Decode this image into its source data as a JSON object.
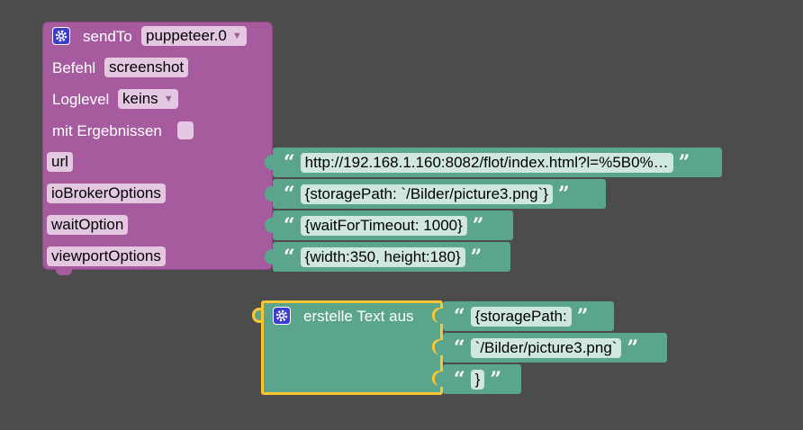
{
  "sendto": {
    "title": "sendTo",
    "instance": "puppeteer.0",
    "befehl_label": "Befehl",
    "befehl_value": "screenshot",
    "loglevel_label": "Loglevel",
    "loglevel_value": "keins",
    "results_label": "mit Ergebnissen",
    "inputs": [
      {
        "label": "url",
        "value": "http://192.168.1.160:8082/flot/index.html?l=%5B0%…"
      },
      {
        "label": "ioBrokerOptions",
        "value": "{storagePath: `/Bilder/picture3.png`}"
      },
      {
        "label": "waitOption",
        "value": "{waitForTimeout: 1000}"
      },
      {
        "label": "viewportOptions",
        "value": "{width:350, height:180}"
      }
    ]
  },
  "create_text": {
    "title": "erstelle Text aus",
    "parts": [
      "{storagePath:",
      "`/Bilder/picture3.png`",
      "}"
    ]
  },
  "colors": {
    "background": "#4c4c4c",
    "sendto_block": "#a55b9e",
    "text_block": "#5ba58c",
    "selection": "#fcc632"
  },
  "icons": {
    "gear": "gear-icon",
    "open_quote": "open-quote-icon",
    "close_quote": "close-quote-icon"
  }
}
